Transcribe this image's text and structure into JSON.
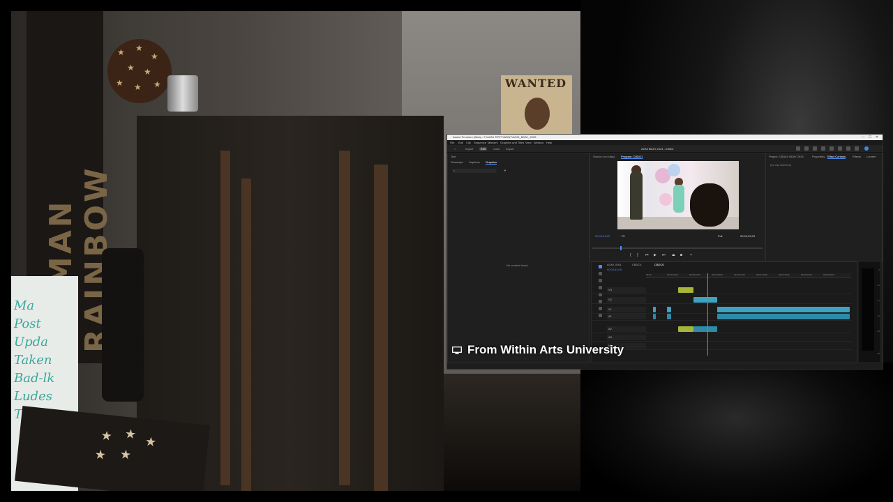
{
  "photo": {
    "banner_text": "WOMAN RAINBOW",
    "poster_title": "WANTED",
    "whiteboard_lines": [
      "Ma",
      "Post",
      "Upda",
      "Taken",
      "Bad-lk",
      "Ludes",
      "Trim"
    ]
  },
  "premiere": {
    "title": "Adobe Premiere (Beta) - F:\\AGNI TIPPY\\WDNT\\AGNI_BDAY_2025",
    "window_controls": [
      "—",
      "☐",
      "✕"
    ],
    "menu": [
      "File",
      "Edit",
      "Clip",
      "Sequence",
      "Markers",
      "Graphics and Titles",
      "View",
      "Window",
      "Help"
    ],
    "workspace_tabs": [
      "Import",
      "Edit",
      "Color",
      "Export"
    ],
    "active_workspace": "Edit",
    "project_name": "AGNI BDAY 2024 - Edited",
    "left_panel": {
      "tabs": [
        "Text",
        "Transcript",
        "Captions",
        "Graphics"
      ],
      "active_tab": "Graphics",
      "empty_message": "No content found"
    },
    "monitor": {
      "tabs": [
        "Source: (no clips)",
        "Program: CBDO1"
      ],
      "timecode_current": "00;00;43;09",
      "fit": "Fit",
      "quality": "Full",
      "timecode_duration": "00;04;22;09"
    },
    "right_panel": {
      "tabs": [
        "Project: CBDAY BDAY 2024",
        "Properties",
        "Effect Controls",
        "Effects",
        "Lumetri"
      ],
      "content": "(no clip selected)"
    },
    "timeline": {
      "tabs": [
        "AGNI_0001",
        "CBDO1",
        "CBDO2"
      ],
      "timecode": "00;00;43;09",
      "ruler": [
        "00;00",
        "00;00;16;00",
        "00;00;32;00",
        "00;00;48;00",
        "00;01;04;00",
        "00;01;20;00",
        "00;01;36;02",
        "00;01;52;02",
        "00;02;08;04"
      ],
      "tracks": [
        "V3",
        "V2",
        "V1",
        "A1",
        "A2",
        "A3",
        "Mix"
      ]
    },
    "meter_scale": [
      "0",
      "-12",
      "-24",
      "-36",
      "-48",
      "dB"
    ]
  },
  "caption": {
    "icon": "monitor-icon",
    "text": "From Within Arts University"
  }
}
